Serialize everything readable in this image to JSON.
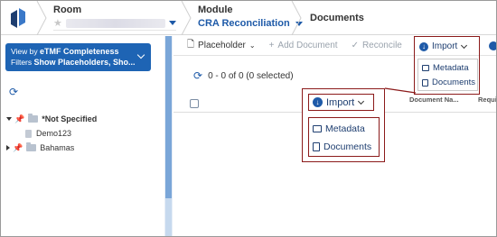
{
  "header": {
    "room_label": "Room",
    "module_label": "Module",
    "module_value": "CRA Reconciliation",
    "page_title": "Documents"
  },
  "sidebar": {
    "view_by_prefix": "View by",
    "view_by_value": "eTMF Completeness",
    "filters_prefix": "Filters",
    "filters_value": "Show Placeholders, Sho...",
    "tree": [
      {
        "label": "*Not Specified"
      },
      {
        "label": "Demo123"
      },
      {
        "label": "Bahamas"
      }
    ]
  },
  "toolbar": {
    "placeholder_label": "Placeholder",
    "add_document_label": "Add Document",
    "reconcile_label": "Reconcile",
    "import_label": "Import"
  },
  "main": {
    "count_text": "0 - 0 of 0 (0 selected)",
    "columns": [
      "Document Na...",
      "Requi"
    ]
  },
  "import_menu": {
    "items": [
      "Metadata",
      "Documents"
    ]
  },
  "colors": {
    "accent": "#1e5aa8",
    "sidebar_button": "#1e64b4",
    "callout": "#8b1a1a"
  }
}
